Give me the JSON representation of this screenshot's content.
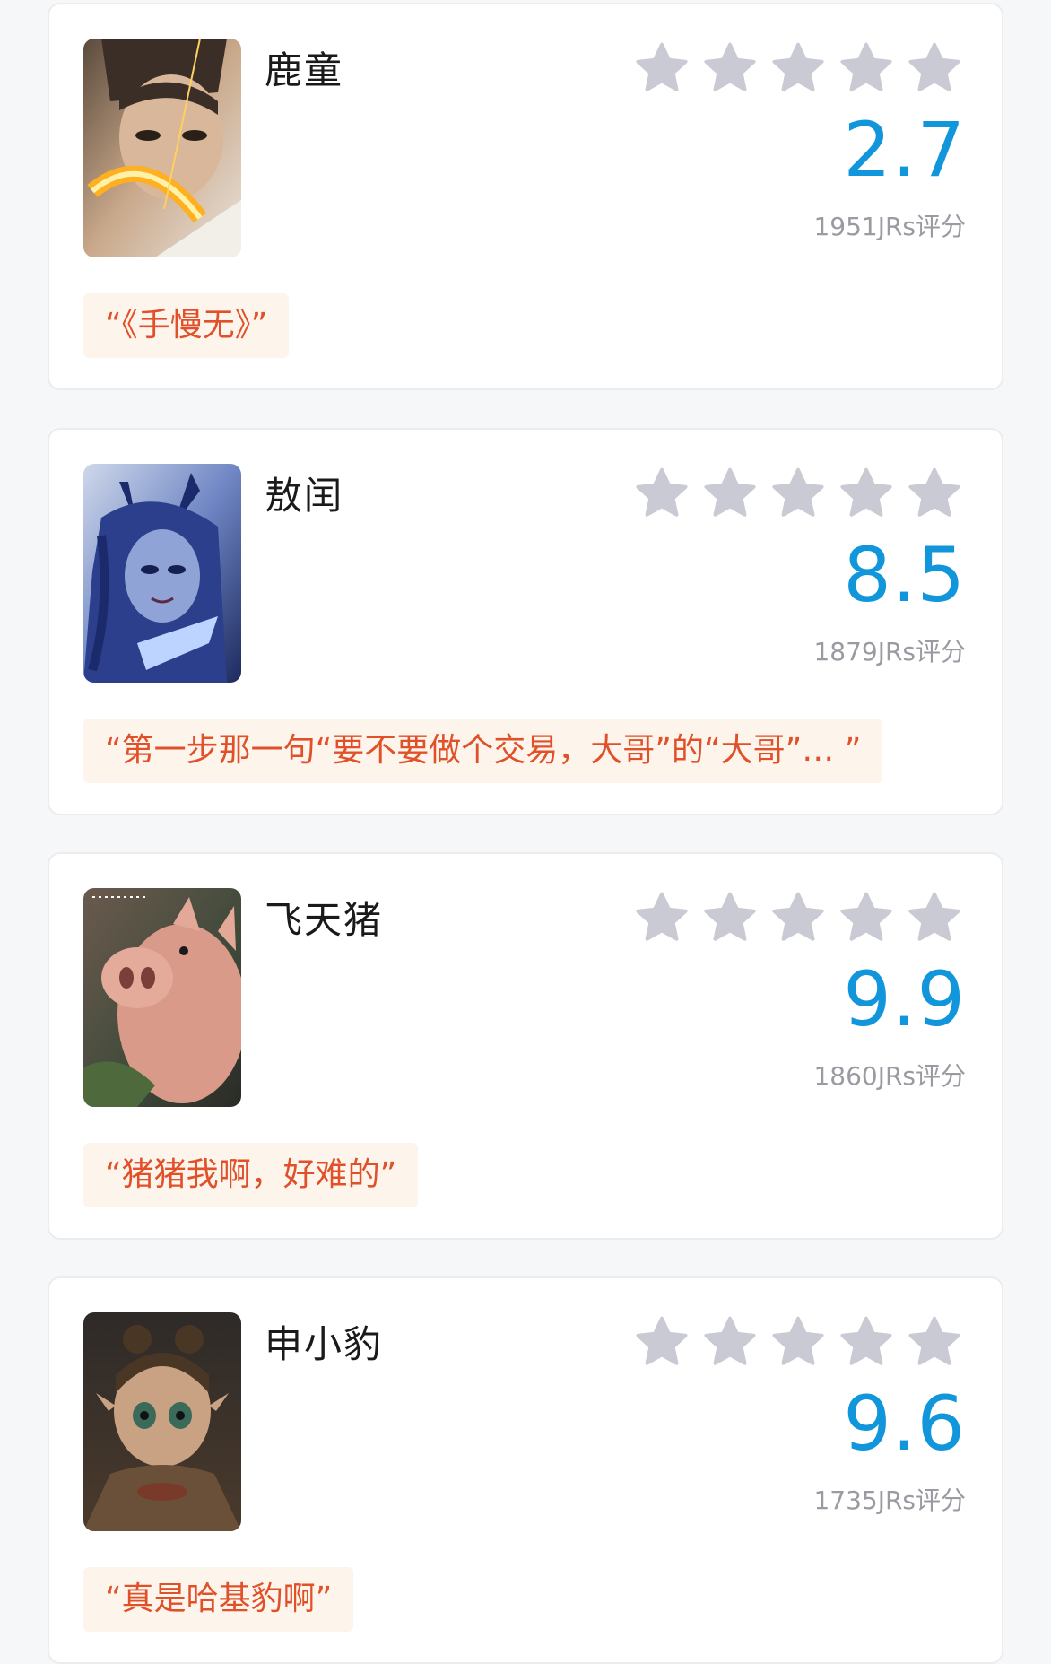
{
  "cards": [
    {
      "name": "鹿童",
      "score": "2.7",
      "rating_count": "1951JRs评分",
      "quote": "“《手慢无》”",
      "avatar_icon": "character-portrait-luTong",
      "filled_stars": 0
    },
    {
      "name": "敖闰",
      "score": "8.5",
      "rating_count": "1879JRs评分",
      "quote": "“第一步那一句“要不要做个交易，大哥”的“大哥”…   ”",
      "avatar_icon": "character-portrait-aoRun",
      "filled_stars": 0
    },
    {
      "name": "飞天猪",
      "score": "9.9",
      "rating_count": "1860JRs评分",
      "quote": "“猪猪我啊，好难的”",
      "avatar_icon": "character-portrait-flying-pig",
      "filled_stars": 0
    },
    {
      "name": "申小豹",
      "score": "9.6",
      "rating_count": "1735JRs评分",
      "quote": "“真是哈基豹啊”",
      "avatar_icon": "character-portrait-shenXiaoBao",
      "filled_stars": 0
    }
  ],
  "colors": {
    "score": "#1296db",
    "quote_text": "#e0512a",
    "quote_bg": "#fdf4ec",
    "star_empty": "#c9cad3"
  }
}
